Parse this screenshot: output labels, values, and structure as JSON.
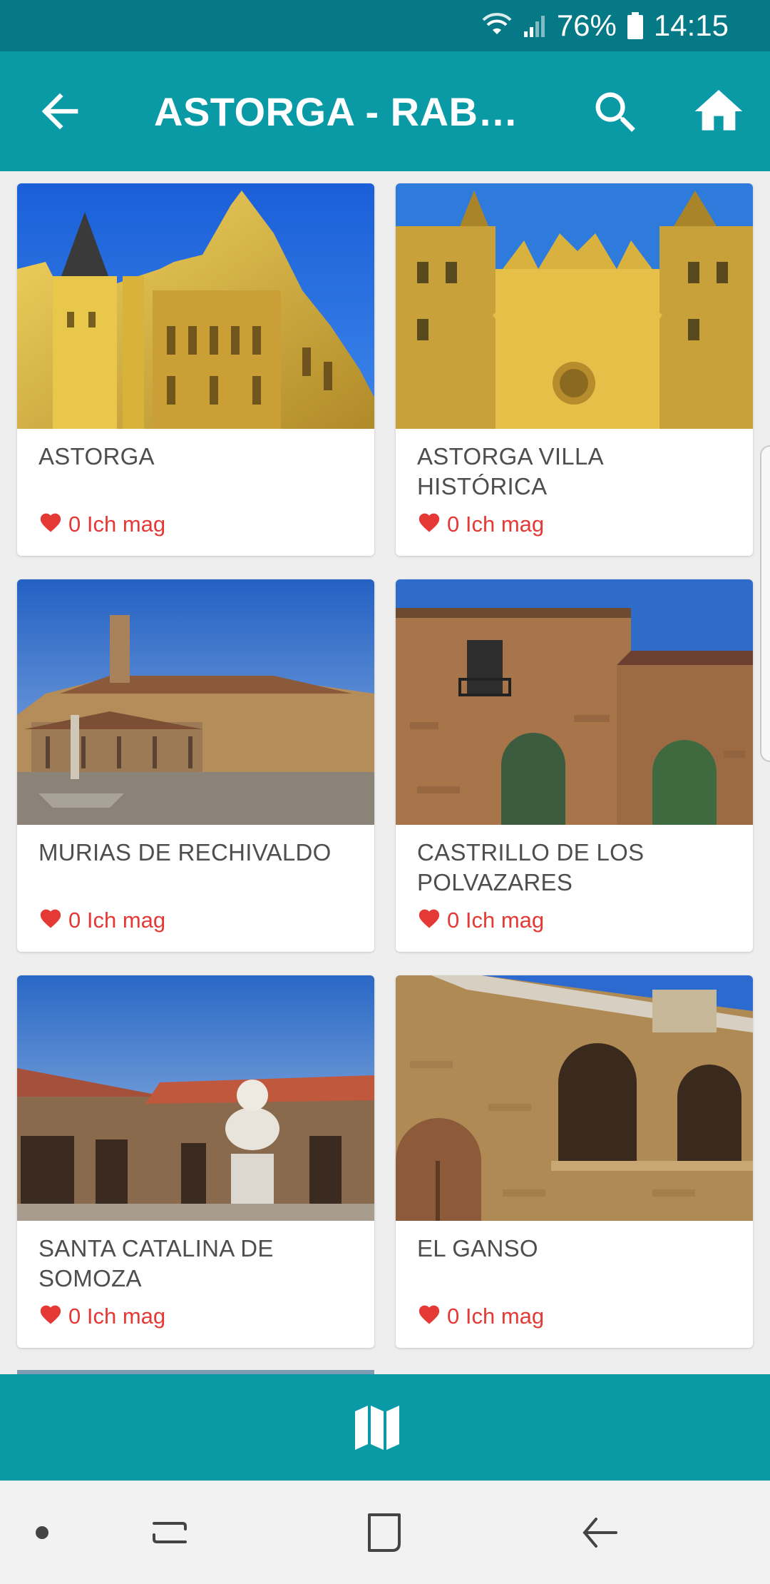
{
  "status_bar": {
    "battery": "76%",
    "time": "14:15"
  },
  "app_bar": {
    "title": "ASTORGA - RABANAL DEL CAMINO"
  },
  "cards": [
    {
      "name": "ASTORGA",
      "likes": "0 Ich mag"
    },
    {
      "name": "ASTORGA VILLA HISTÓRICA",
      "likes": "0 Ich mag"
    },
    {
      "name": "MURIAS DE RECHIVALDO",
      "likes": "0 Ich mag"
    },
    {
      "name": "CASTRILLO DE LOS POLVAZARES",
      "likes": "0 Ich mag"
    },
    {
      "name": "SANTA CATALINA DE SOMOZA",
      "likes": "0 Ich mag"
    },
    {
      "name": "EL GANSO",
      "likes": "0 Ich mag"
    }
  ],
  "icons": {
    "back": "arrow-left-icon",
    "search": "search-icon",
    "home": "home-icon",
    "like": "heart-icon",
    "map": "map-icon"
  },
  "colors": {
    "primary": "#0a9aa6",
    "status_bar": "#057985",
    "like": "#e53935"
  }
}
